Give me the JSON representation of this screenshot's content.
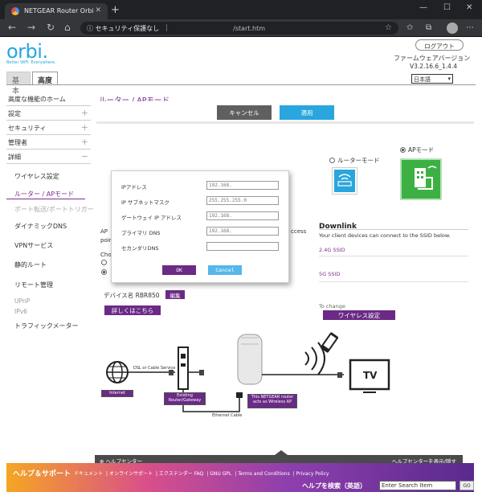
{
  "browser": {
    "tab_title": "NETGEAR Router Orbi",
    "security_label": "セキュリティ保護なし",
    "url": "/start.htm"
  },
  "header": {
    "logo": "orbi.",
    "tagline": "Better WiFi. Everywhere.",
    "logout": "ログアウト",
    "firmware_label": "ファームウェアバージョン",
    "firmware_version": "V3.2.16.6_1.4.4",
    "language": "日本語",
    "tabs": {
      "basic": "基本",
      "advanced": "高度"
    }
  },
  "sidebar": {
    "home": "高度な機能のホーム",
    "settings": "設定",
    "security": "セキュリティ",
    "admin": "管理者",
    "details": "詳細",
    "items": [
      "ワイヤレス設定",
      "ルーター / APモード",
      "ポート転送/ポートトリガー",
      "ダイナミックDNS",
      "VPNサービス",
      "静的ルート",
      "リモート管理",
      "UPnP",
      "IPv6",
      "トラフィックメーター"
    ]
  },
  "main": {
    "title": "ルーター / APモード",
    "cancel": "キャンセル",
    "apply": "適用",
    "router_mode": "ルーターモード",
    "ap_mode": "APモード",
    "downlink_title": "Downlink",
    "downlink_desc": "Your client devices can connect to the SSID below.",
    "ssid_24": "2.4G SSID",
    "ssid_5": "5G SSID",
    "to_change": "To change",
    "wifi_settings_btn": "ワイヤレス設定",
    "device_name_label": "デバイス名",
    "device_name": "RBR850",
    "edit": "編集",
    "more_info": "詳しくはこちら",
    "bg_ap": "AP",
    "bg_ccess": "ccess",
    "bg_poir": "poir",
    "bg_cho": "Cho"
  },
  "diagram": {
    "internet": "Internet",
    "dsl": "DSL or Cable Service",
    "existing": "Existing Router/Gateway",
    "this_router": "This NETGEAR router acts as Wireless AP",
    "ethernet": "Ethernet Cable",
    "tv": "TV"
  },
  "modal": {
    "fields": [
      {
        "label": "IPアドレス",
        "value": "192.168."
      },
      {
        "label": "IP サブネットマスク",
        "value": "255.255.255.0"
      },
      {
        "label": "ゲートウェイ IP アドレス",
        "value": "192.168."
      },
      {
        "label": "プライマリ DNS",
        "value": "192.168."
      },
      {
        "label": "セカンダリDNS",
        "value": ""
      }
    ],
    "ok": "OK",
    "cancel": "Cancel"
  },
  "footer": {
    "help_center": "ヘルプセンター",
    "show_help": "ヘルプセンターを表示/隠す",
    "support_title": "ヘルプ＆サポート",
    "links": [
      "ドキュメント",
      "オンラインサポート",
      "エクステンダー FAQ",
      "GNU GPL",
      "Terms and Conditions",
      "Privacy Policy"
    ],
    "search_label": "ヘルプを検索（英語）",
    "search_placeholder": "Enter Search Item",
    "go": "GO"
  },
  "colors": {
    "accent_purple": "#6b2a86",
    "accent_blue": "#29a6de",
    "ap_green": "#3cb043"
  }
}
